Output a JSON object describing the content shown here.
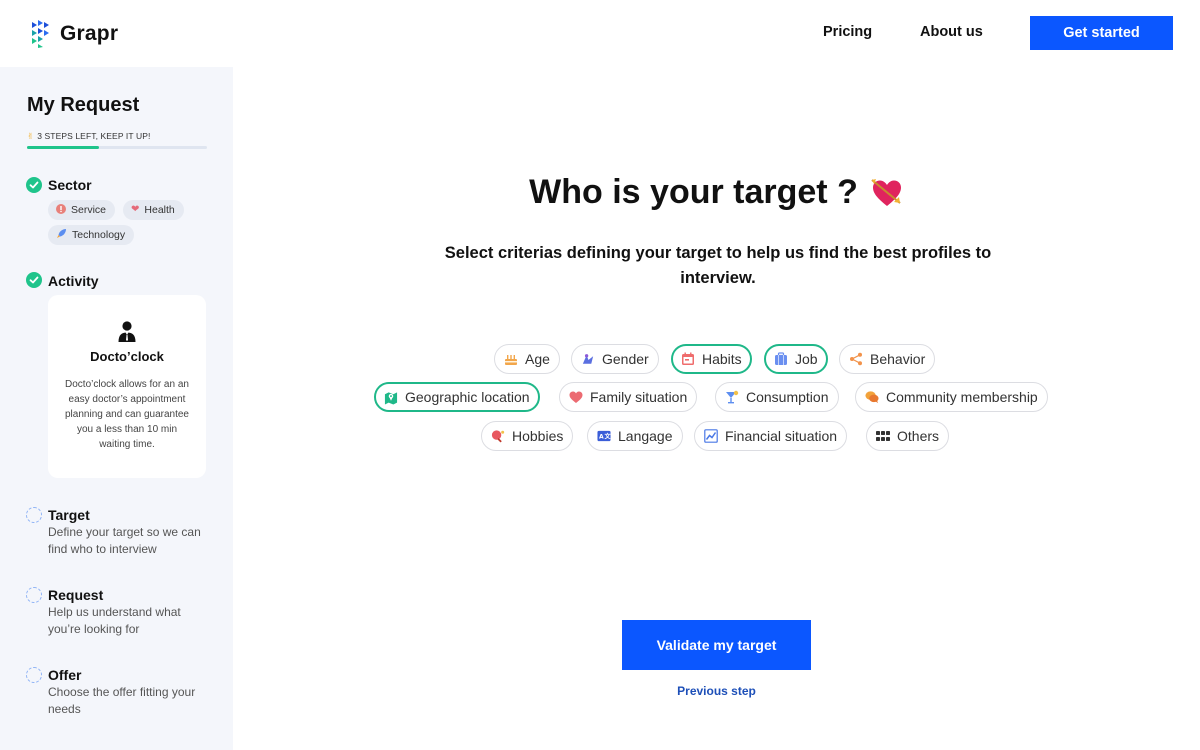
{
  "header": {
    "logo_text": "Grapr",
    "logo_icon": "grapr-logo-icon",
    "nav": {
      "pricing": "Pricing",
      "about": "About us"
    },
    "cta_label": "Get started"
  },
  "sidebar": {
    "title": "My Request",
    "progress_label": "3 STEPS LEFT, KEEP IT UP!",
    "progress_icon": "waving-hand-icon",
    "progress_fraction": 0.4,
    "steps": [
      {
        "title": "Sector",
        "status": "done",
        "tags": [
          {
            "label": "Service",
            "icon": "service-icon"
          },
          {
            "label": "Health",
            "icon": "heart-icon"
          },
          {
            "label": "Technology",
            "icon": "rocket-icon"
          }
        ]
      },
      {
        "title": "Activity",
        "status": "done",
        "card": {
          "name": "Docto’clock",
          "description": "Docto’clock allows for an an easy doctor’s appointment planning and can guarantee you a less than 10 min waiting time."
        }
      },
      {
        "title": "Target",
        "status": "todo",
        "description": "Define your target so we can find who to interview"
      },
      {
        "title": "Request",
        "status": "todo",
        "description": "Help us understand what you’re looking for"
      },
      {
        "title": "Offer",
        "status": "todo",
        "description": "Choose the offer fitting your needs"
      }
    ]
  },
  "main": {
    "title": "Who is your target ?",
    "title_icon": "heart-with-arrow-icon",
    "subtitle": "Select criterias defining your target to help us find the best profiles to interview.",
    "criteria": [
      {
        "label": "Age",
        "icon": "cake-icon",
        "selected": false
      },
      {
        "label": "Gender",
        "icon": "gender-icon",
        "selected": false
      },
      {
        "label": "Habits",
        "icon": "calendar-icon",
        "selected": true
      },
      {
        "label": "Job",
        "icon": "briefcase-icon",
        "selected": true
      },
      {
        "label": "Behavior",
        "icon": "share-icon",
        "selected": false
      },
      {
        "label": "Geographic location",
        "icon": "map-icon",
        "selected": true
      },
      {
        "label": "Family situation",
        "icon": "heart-icon",
        "selected": false
      },
      {
        "label": "Consumption",
        "icon": "cocktail-icon",
        "selected": false
      },
      {
        "label": "Community membership",
        "icon": "chat-bubbles-icon",
        "selected": false
      },
      {
        "label": "Hobbies",
        "icon": "ping-pong-icon",
        "selected": false
      },
      {
        "label": "Langage",
        "icon": "translate-icon",
        "selected": false
      },
      {
        "label": "Financial situation",
        "icon": "chart-icon",
        "selected": false
      },
      {
        "label": "Others",
        "icon": "grid-icon",
        "selected": false
      }
    ],
    "validate_label": "Validate my target",
    "previous_label": "Previous step"
  },
  "colors": {
    "primary": "#0b57ff",
    "success": "#1fc48b",
    "sidebar_bg": "#f4f6fb",
    "link": "#1d4fb8"
  }
}
